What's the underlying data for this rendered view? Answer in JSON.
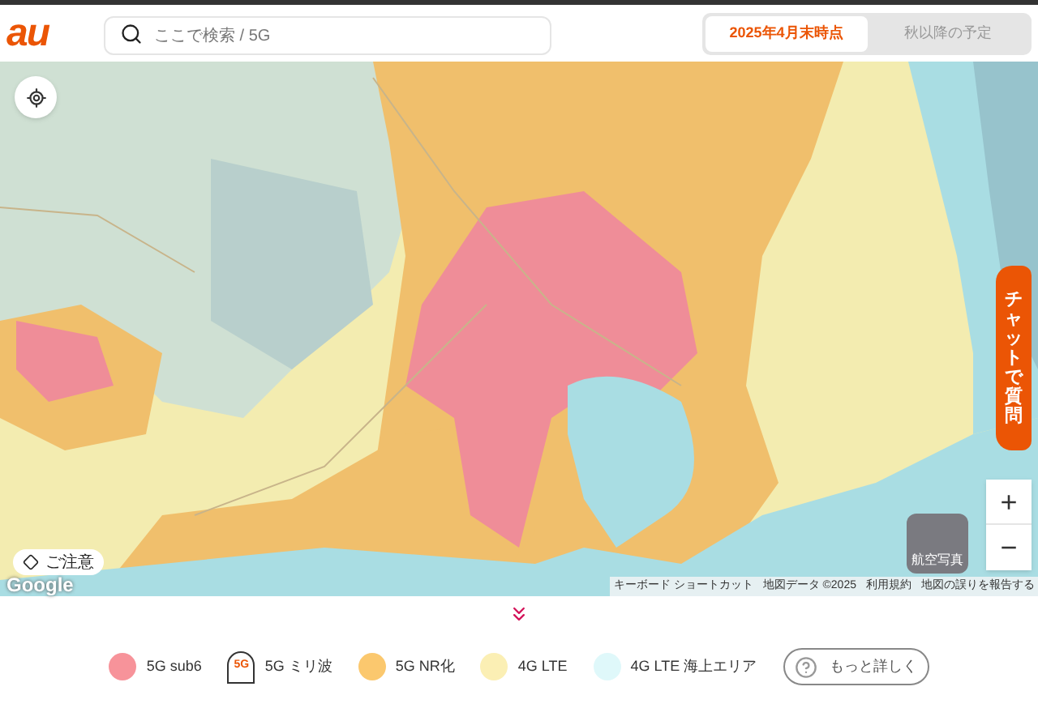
{
  "header": {
    "logo": "au",
    "search": {
      "placeholder": "ここで検索 / 5G"
    },
    "tabs": [
      {
        "label": "2025年4月末時点",
        "selected": true
      },
      {
        "label": "秋以降の予定",
        "selected": false
      }
    ]
  },
  "map": {
    "caution_button": "ご注意",
    "google_logo": "Google",
    "attribution": [
      "キーボード ショートカット",
      "地図データ ©2025",
      "利用規約",
      "地図の誤りを報告する"
    ],
    "aerial_button": "航空写真",
    "zoom": {
      "in": "+",
      "out": "−"
    },
    "chat_tab": "チャットで質問"
  },
  "legend": {
    "items": [
      {
        "kind": "dot",
        "label": "5G sub6",
        "color": "#f7939a"
      },
      {
        "kind": "pin",
        "badge": "5G",
        "label": "5G ミリ波"
      },
      {
        "kind": "dot",
        "label": "5G NR化",
        "color": "#fbc86e"
      },
      {
        "kind": "dot",
        "label": "4G LTE",
        "color": "#fbefb4"
      },
      {
        "kind": "dot",
        "label": "4G LTE 海上エリア",
        "color": "#dff8fa"
      }
    ],
    "more_button": "もっと詳しく"
  }
}
